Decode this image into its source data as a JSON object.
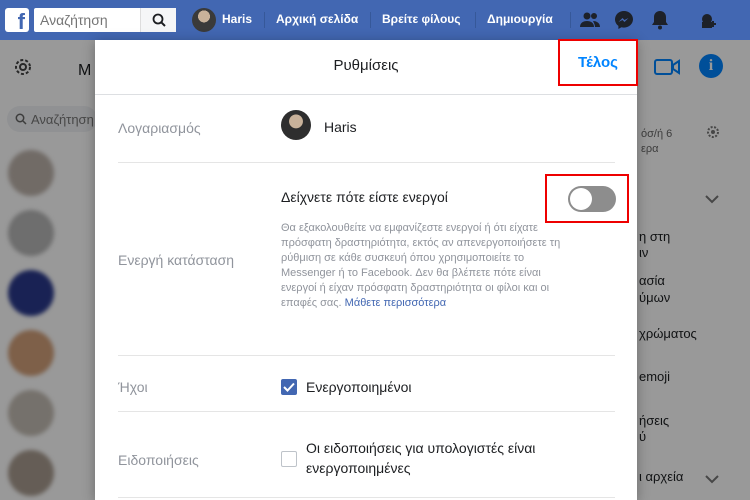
{
  "topbar": {
    "logo": "f",
    "search_placeholder": "Αναζήτηση",
    "user_name": "Haris",
    "home": "Αρχική σελίδα",
    "find_friends": "Βρείτε φίλους",
    "create": "Δημιουργία"
  },
  "background": {
    "left_header": "M",
    "left_search": "Αναζήτηση",
    "right_lines": [
      "όσ/ή 6",
      "ερα",
      "η στη",
      "ιν",
      "ασία",
      "ύμων",
      "χρώματος",
      "emoji",
      "ήσεις",
      "ύ",
      "ι αρχεία"
    ]
  },
  "modal": {
    "title": "Ρυθμίσεις",
    "done_label": "Τέλος",
    "account": {
      "label": "Λογαριασμός",
      "name": "Haris"
    },
    "active_status": {
      "label": "Ενεργή κατάσταση",
      "title": "Δείχνετε πότε είστε ενεργοί",
      "enabled": false,
      "description": "Θα εξακολουθείτε να εμφανίζεστε ενεργοί ή ότι είχατε πρόσφατη δραστηριότητα, εκτός αν απενεργοποιήσετε τη ρύθμιση σε κάθε συσκευή όπου χρησιμοποιείτε το Messenger ή το Facebook. Δεν θα βλέπετε πότε είναι ενεργοί ή είχαν πρόσφατη δραστηριότητα οι φίλοι και οι επαφές σας.",
      "learn_more": "Μάθετε περισσότερα"
    },
    "sounds": {
      "label": "Ήχοι",
      "option": "Ενεργοποιημένοι",
      "checked": true
    },
    "notifications": {
      "label": "Ειδοποιήσεις",
      "option": "Οι ειδοποιήσεις για υπολογιστές είναι ενεργοποιημένες",
      "checked": false
    }
  },
  "colors": {
    "topbar": "#4267b2",
    "messenger_blue": "#0084ff",
    "highlight": "#ee0000"
  }
}
